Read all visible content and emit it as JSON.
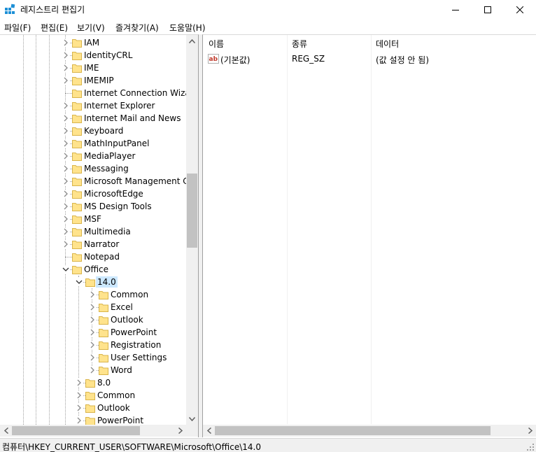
{
  "window": {
    "title": "레지스트리 편집기"
  },
  "menu": [
    "파일(F)",
    "편집(E)",
    "보기(V)",
    "즐겨찾기(A)",
    "도움말(H)"
  ],
  "tree": {
    "items": [
      {
        "label": "IAM",
        "level": 0,
        "expander": "collapsed"
      },
      {
        "label": "IdentityCRL",
        "level": 0,
        "expander": "collapsed"
      },
      {
        "label": "IME",
        "level": 0,
        "expander": "collapsed"
      },
      {
        "label": "IMEMIP",
        "level": 0,
        "expander": "collapsed"
      },
      {
        "label": "Internet Connection Wizard",
        "level": 0,
        "expander": "none"
      },
      {
        "label": "Internet Explorer",
        "level": 0,
        "expander": "collapsed"
      },
      {
        "label": "Internet Mail and News",
        "level": 0,
        "expander": "collapsed"
      },
      {
        "label": "Keyboard",
        "level": 0,
        "expander": "collapsed"
      },
      {
        "label": "MathInputPanel",
        "level": 0,
        "expander": "collapsed"
      },
      {
        "label": "MediaPlayer",
        "level": 0,
        "expander": "collapsed"
      },
      {
        "label": "Messaging",
        "level": 0,
        "expander": "collapsed"
      },
      {
        "label": "Microsoft Management Console",
        "level": 0,
        "expander": "collapsed"
      },
      {
        "label": "MicrosoftEdge",
        "level": 0,
        "expander": "collapsed"
      },
      {
        "label": "MS Design Tools",
        "level": 0,
        "expander": "collapsed"
      },
      {
        "label": "MSF",
        "level": 0,
        "expander": "collapsed"
      },
      {
        "label": "Multimedia",
        "level": 0,
        "expander": "collapsed"
      },
      {
        "label": "Narrator",
        "level": 0,
        "expander": "collapsed"
      },
      {
        "label": "Notepad",
        "level": 0,
        "expander": "none"
      },
      {
        "label": "Office",
        "level": 0,
        "expander": "expanded"
      },
      {
        "label": "14.0",
        "level": 1,
        "expander": "expanded",
        "selected": true
      },
      {
        "label": "Common",
        "level": 2,
        "expander": "collapsed"
      },
      {
        "label": "Excel",
        "level": 2,
        "expander": "collapsed"
      },
      {
        "label": "Outlook",
        "level": 2,
        "expander": "collapsed"
      },
      {
        "label": "PowerPoint",
        "level": 2,
        "expander": "collapsed"
      },
      {
        "label": "Registration",
        "level": 2,
        "expander": "collapsed"
      },
      {
        "label": "User Settings",
        "level": 2,
        "expander": "collapsed"
      },
      {
        "label": "Word",
        "level": 2,
        "expander": "collapsed"
      },
      {
        "label": "8.0",
        "level": 1,
        "expander": "collapsed"
      },
      {
        "label": "Common",
        "level": 1,
        "expander": "collapsed"
      },
      {
        "label": "Outlook",
        "level": 1,
        "expander": "collapsed"
      },
      {
        "label": "PowerPoint",
        "level": 1,
        "expander": "collapsed"
      }
    ]
  },
  "list": {
    "columns": [
      "이름",
      "종류",
      "데이터"
    ],
    "rows": [
      {
        "name": "(기본값)",
        "type": "REG_SZ",
        "data": "(값 설정 안 됨)",
        "icon": "string-value-icon"
      }
    ]
  },
  "status": {
    "path": "컴퓨터\\HKEY_CURRENT_USER\\SOFTWARE\\Microsoft\\Office\\14.0"
  },
  "colors": {
    "selection": "#cce8ff",
    "folder": "#ffe38c",
    "folder_edge": "#d9b44a"
  }
}
